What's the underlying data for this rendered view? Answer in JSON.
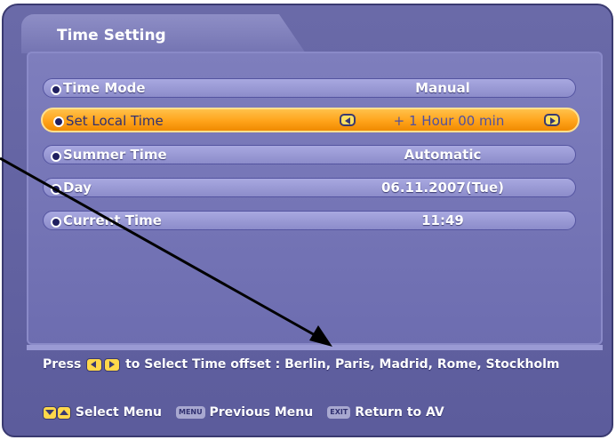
{
  "title": "Time Setting",
  "menu": [
    {
      "label": "Time Mode",
      "value": "Manual",
      "selected": false
    },
    {
      "label": "Set Local Time",
      "value": "+ 1 Hour 00 min",
      "selected": true
    },
    {
      "label": "Summer Time",
      "value": "Automatic",
      "selected": false
    },
    {
      "label": "Day",
      "value": "06.11.2007(Tue)",
      "selected": false
    },
    {
      "label": "Current Time",
      "value": "11:49",
      "selected": false
    }
  ],
  "help": {
    "press": "Press",
    "text": "to Select Time offset : Berlin, Paris, Madrid, Rome, Stockholm"
  },
  "footer": {
    "select_menu": "Select Menu",
    "menu_key": "MENU",
    "previous_menu": "Previous Menu",
    "exit_key": "EXIT",
    "return_av": "Return to AV"
  },
  "colors": {
    "background": "#6a6aa8",
    "row": "#a8a8e0",
    "selected_row": "#ffa31a",
    "key_button": "#ffd84a"
  },
  "icons": [
    "left-arrow-icon",
    "right-arrow-icon",
    "down-arrow-icon",
    "up-arrow-icon"
  ]
}
